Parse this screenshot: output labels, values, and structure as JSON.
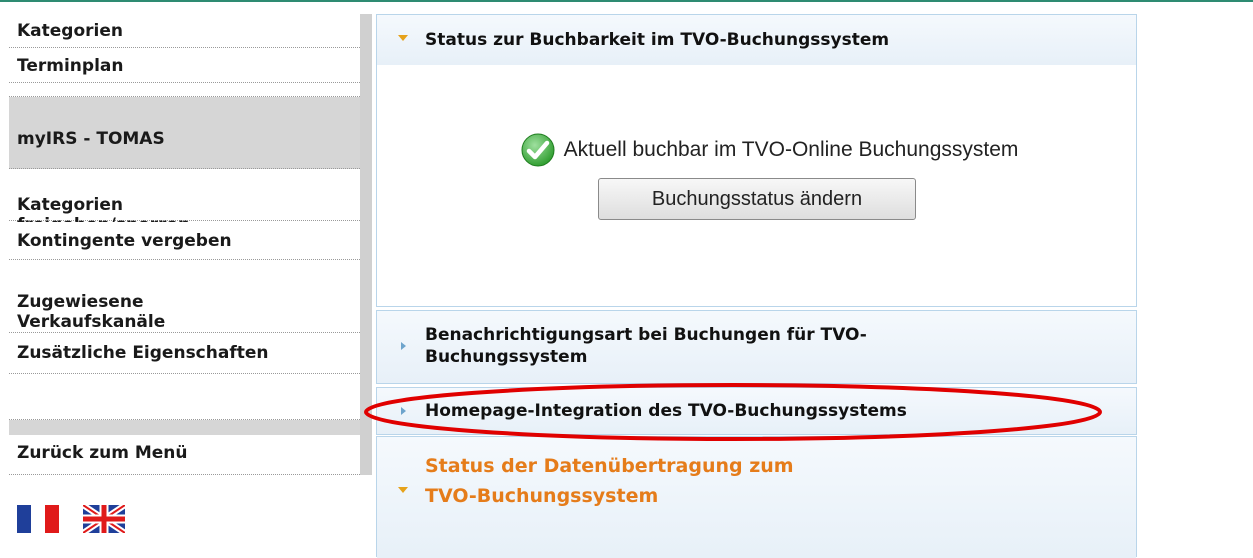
{
  "sidebar": {
    "items": [
      {
        "label": "Kategorien"
      },
      {
        "label": "Terminplan"
      },
      {
        "label": "myIRS - TOMAS"
      },
      {
        "label": "Kategorien\nfreigeben/sperren"
      },
      {
        "label": "Kontingente vergeben"
      },
      {
        "label": "Zugewiesene\nVerkaufskanäle"
      },
      {
        "label": "Zusätzliche Eigenschaften"
      },
      {
        "label": "Zurück zum Menü"
      }
    ]
  },
  "flags": {
    "french": "flag-fr-icon",
    "english": "flag-uk-icon"
  },
  "panels": {
    "status": {
      "title": "Status zur Buchbarkeit im TVO-Buchungssystem",
      "status_text": "Aktuell buchbar im TVO-Online Buchungssystem",
      "button_label": "Buchungsstatus ändern"
    },
    "notification": {
      "title": "Benachrichtigungsart bei Buchungen für TVO-Buchungssystem"
    },
    "homepage": {
      "title": "Homepage-Integration des TVO-Buchungssystems"
    },
    "transfer": {
      "title": "Status der Datenübertragung zum TVO-Buchungssystem"
    }
  },
  "colors": {
    "accent_orange": "#e57c1a",
    "highlight_red": "#e00000",
    "status_green": "#3cb43c"
  }
}
